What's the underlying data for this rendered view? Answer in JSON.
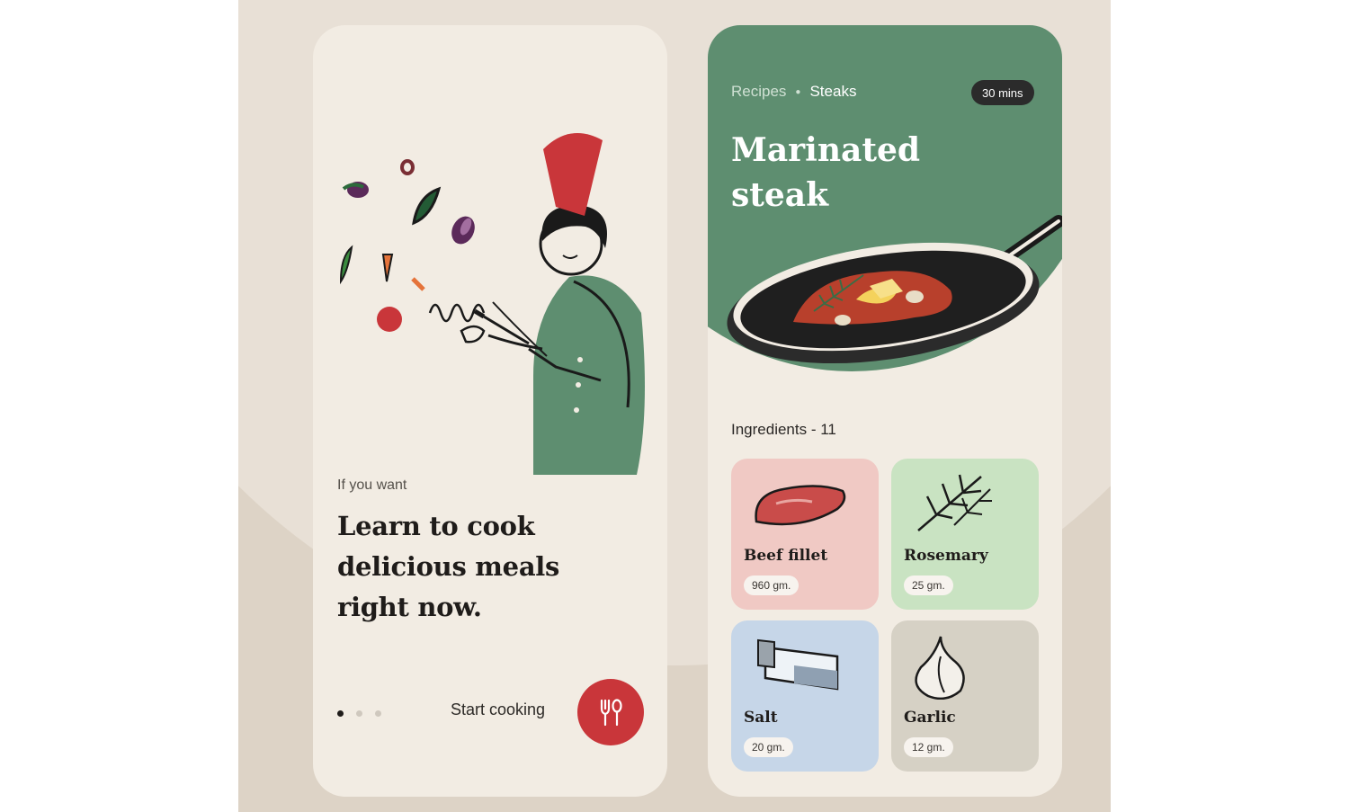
{
  "onboarding": {
    "eyebrow": "If you want",
    "headline": "Learn to cook delicious meals right now.",
    "pager": {
      "count": 3,
      "active_index": 0
    },
    "start_label": "Start cooking",
    "start_icon": "fork-spoon-icon",
    "colors": {
      "accent": "#c9363a",
      "chef_coat": "#5e8e70"
    }
  },
  "recipe": {
    "breadcrumb": [
      "Recipes",
      "Steaks"
    ],
    "time": "30 mins",
    "title": "Marinated steak",
    "ingredients_heading": "Ingredients - 11",
    "ingredients": [
      {
        "name": "Beef fillet",
        "qty": "960 gm.",
        "color": "#f0c9c4",
        "icon": "steak-icon"
      },
      {
        "name": "Rosemary",
        "qty": "25 gm.",
        "color": "#c9e3c2",
        "icon": "rosemary-icon"
      },
      {
        "name": "Salt",
        "qty": "20 gm.",
        "color": "#c6d6e8",
        "icon": "salt-shaker-icon"
      },
      {
        "name": "Garlic",
        "qty": "12 gm.",
        "color": "#d6d1c5",
        "icon": "garlic-icon"
      }
    ],
    "colors": {
      "hero": "#5e8e70"
    }
  }
}
